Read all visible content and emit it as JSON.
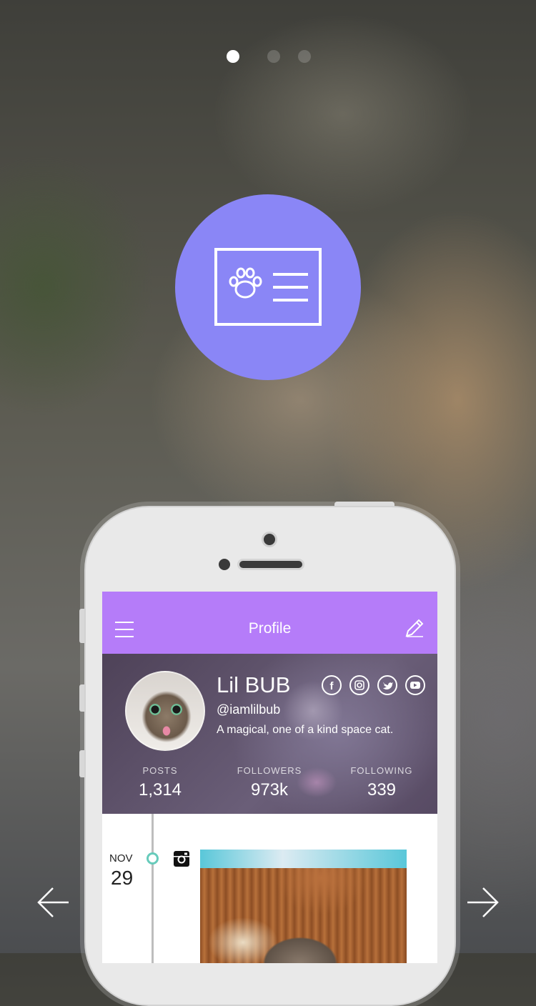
{
  "pager": {
    "pages": 3,
    "active": 0
  },
  "hero": {
    "icon": "id-card-paw-icon",
    "circle_color": "#8a86f6"
  },
  "app": {
    "title": "Profile",
    "header_color": "#b57cf9",
    "menu_icon": "hamburger-menu-icon",
    "edit_icon": "pencil-edit-icon"
  },
  "profile": {
    "name": "Lil BUB",
    "handle": "@iamlilbub",
    "bio": "A magical, one of a kind space cat.",
    "social": [
      "facebook-icon",
      "instagram-icon",
      "twitter-icon",
      "youtube-icon"
    ],
    "stats": [
      {
        "label": "POSTS",
        "value": "1,314"
      },
      {
        "label": "FOLLOWERS",
        "value": "973k"
      },
      {
        "label": "FOLLOWING",
        "value": "339"
      }
    ]
  },
  "feed": {
    "items": [
      {
        "month": "NOV",
        "day": "29",
        "source_icon": "instagram-icon"
      }
    ],
    "accent": "#67cbbb"
  },
  "navigation": {
    "back_icon": "arrow-left-icon",
    "next_icon": "arrow-right-icon"
  }
}
